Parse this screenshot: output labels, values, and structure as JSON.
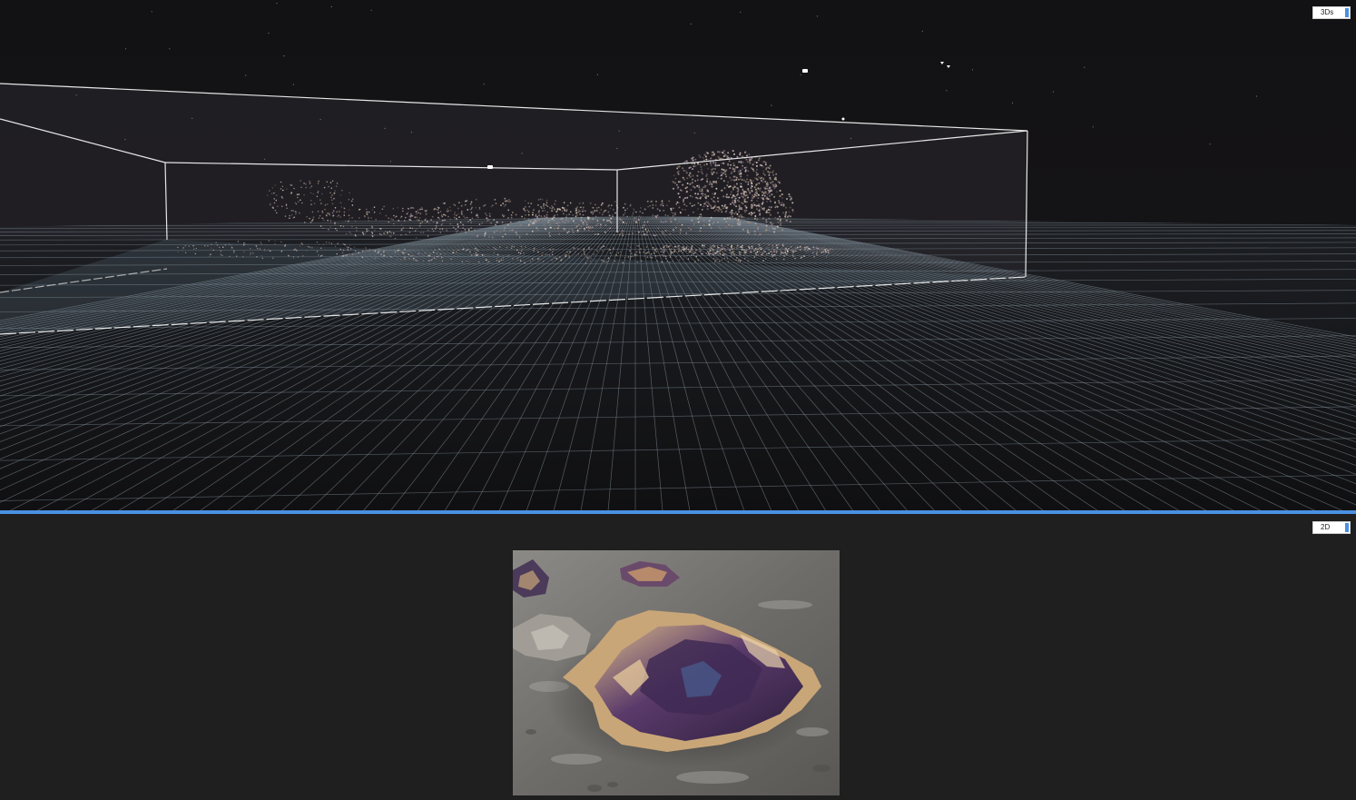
{
  "viewports": {
    "top": {
      "mode_label": "3Ds"
    },
    "bottom": {
      "mode_label": "2D"
    }
  },
  "colors": {
    "background_3d": "#121113",
    "background_2d": "#1f1f1f",
    "splitter": "#4a90e2",
    "grid": "#8a9aa6"
  },
  "icons": [
    "camera-marker-icon"
  ]
}
